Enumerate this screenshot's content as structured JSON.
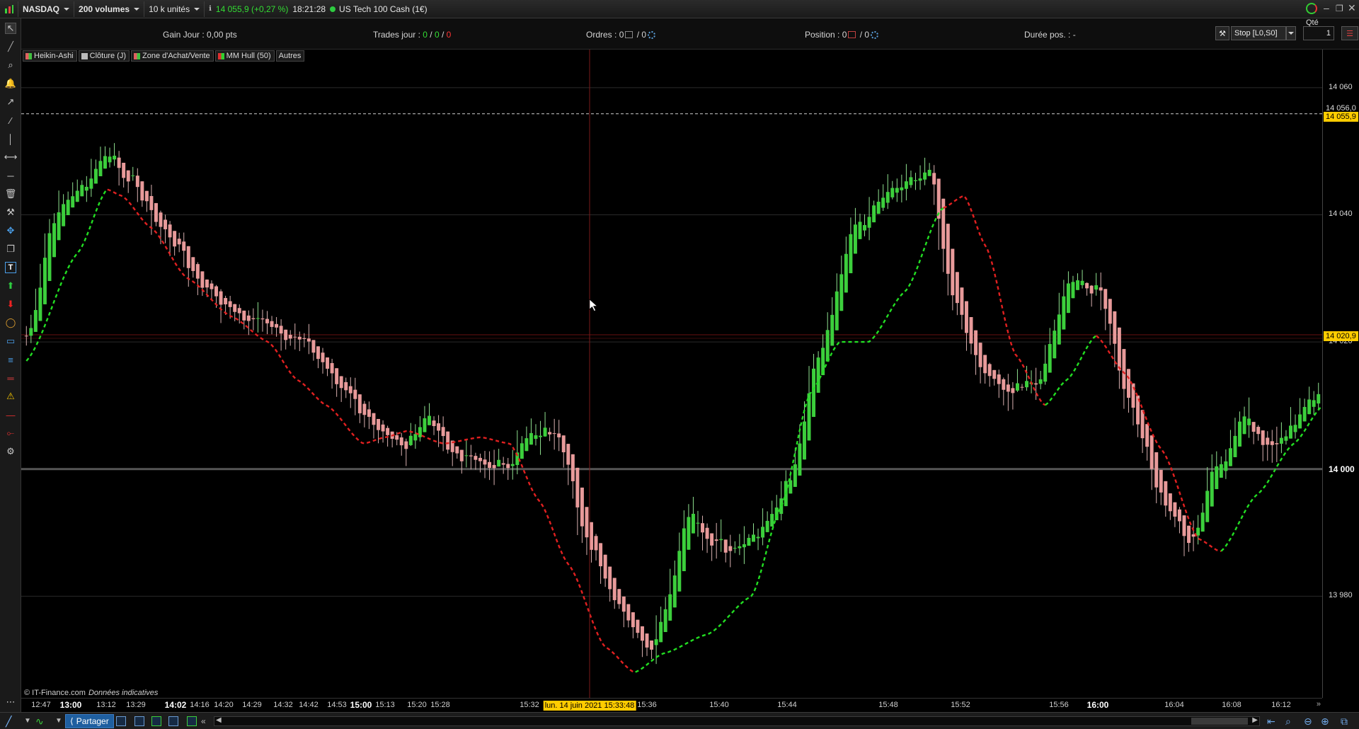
{
  "toolbar": {
    "market": "NASDAQ",
    "volume": "200 volumes",
    "units": "10 k unités",
    "price_change": "14 055,9 (+0,27 %)",
    "time": "18:21:28",
    "instrument": "US Tech 100 Cash (1€)",
    "qty_label": "Qté"
  },
  "infobar": {
    "gain_label": "Gain Jour :",
    "gain_value": "0,00 pts",
    "trades_label": "Trades jour :",
    "trades_a": "0",
    "trades_b": "0",
    "trades_c": "0",
    "orders_label": "Ordres :",
    "orders_a": "0",
    "orders_b": "0",
    "position_label": "Position :",
    "position_a": "0",
    "position_b": "0",
    "duration_label": "Durée pos. :",
    "duration_value": "-"
  },
  "order_entry": {
    "order_type": "Stop [L0,S0]",
    "quantity": "1"
  },
  "legend": [
    {
      "label": "Heikin-Ashi",
      "color": "#e06060",
      "color2": "#40c040"
    },
    {
      "label": "Clôture (J)",
      "color": "#bbbbbb"
    },
    {
      "label": "Zone d'Achat/Vente",
      "color": "#e06060",
      "color2": "#40c040"
    },
    {
      "label": "MM Hull (50)",
      "color": "#e03030",
      "color2": "#30d030"
    },
    {
      "label": "Autres",
      "color": ""
    }
  ],
  "chart_data": {
    "type": "candlestick",
    "instrument": "US Tech 100 Cash (1€)",
    "ylim": [
      13964,
      14066
    ],
    "yticks": [
      {
        "label": "14 060",
        "value": 14060,
        "bold": false
      },
      {
        "label": "14 040",
        "value": 14040,
        "bold": false
      },
      {
        "label": "14 020",
        "value": 14020,
        "bold": false
      },
      {
        "label": "14 000",
        "value": 14000,
        "bold": true
      },
      {
        "label": "13 980",
        "value": 13980,
        "bold": false
      }
    ],
    "price_badges": [
      {
        "label": "14 056,0",
        "value": 14056.0,
        "style": "plain"
      },
      {
        "label": "14 055,9",
        "value": 14055.9,
        "style": "yellow"
      },
      {
        "label": "14 020,9",
        "value": 14020.9,
        "style": "yellow"
      }
    ],
    "hlines": [
      {
        "value": 14055.9,
        "style": "dashed-white"
      },
      {
        "value": 14020.9,
        "style": "solid-darkred"
      },
      {
        "value": 14000,
        "style": "thick-grey"
      }
    ],
    "xticks": [
      {
        "label": "12:47",
        "bold": false
      },
      {
        "label": "13:00",
        "bold": true
      },
      {
        "label": "13:12",
        "bold": false
      },
      {
        "label": "13:29",
        "bold": false
      },
      {
        "label": "14:02",
        "bold": true
      },
      {
        "label": "14:16",
        "bold": false
      },
      {
        "label": "14:20",
        "bold": false
      },
      {
        "label": "14:29",
        "bold": false
      },
      {
        "label": "14:32",
        "bold": false
      },
      {
        "label": "14:42",
        "bold": false
      },
      {
        "label": "14:53",
        "bold": false
      },
      {
        "label": "15:00",
        "bold": true
      },
      {
        "label": "15:13",
        "bold": false
      },
      {
        "label": "15:20",
        "bold": false
      },
      {
        "label": "15:28",
        "bold": false
      },
      {
        "label": "15:32",
        "bold": false
      },
      {
        "label": "15:36",
        "bold": false
      },
      {
        "label": "15:40",
        "bold": false
      },
      {
        "label": "15:44",
        "bold": false
      },
      {
        "label": "15:48",
        "bold": false
      },
      {
        "label": "15:52",
        "bold": false
      },
      {
        "label": "15:56",
        "bold": false
      },
      {
        "label": "16:00",
        "bold": true
      },
      {
        "label": "16:04",
        "bold": false
      },
      {
        "label": "16:08",
        "bold": false
      },
      {
        "label": "16:12",
        "bold": false
      }
    ],
    "cursor_label": "lun. 14 juin 2021 15:33:48",
    "candle_count": 280,
    "close_path": [
      [
        0,
        14021
      ],
      [
        7,
        14040
      ],
      [
        14,
        14044
      ],
      [
        22,
        14050
      ],
      [
        28,
        14045
      ],
      [
        38,
        14037
      ],
      [
        48,
        14029
      ],
      [
        58,
        14024
      ],
      [
        66,
        14023
      ],
      [
        75,
        14020
      ],
      [
        86,
        14013
      ],
      [
        96,
        14005
      ],
      [
        102,
        14004
      ],
      [
        108,
        14008
      ],
      [
        118,
        14002
      ],
      [
        128,
        14000
      ],
      [
        138,
        14005
      ],
      [
        144,
        14007
      ],
      [
        152,
        13990
      ],
      [
        162,
        13978
      ],
      [
        170,
        13972
      ],
      [
        175,
        13980
      ],
      [
        180,
        13993
      ],
      [
        186,
        13989
      ],
      [
        192,
        13988
      ],
      [
        200,
        13990
      ],
      [
        208,
        13998
      ],
      [
        216,
        14018
      ],
      [
        226,
        14038
      ],
      [
        236,
        14044
      ],
      [
        246,
        14047
      ],
      [
        252,
        14028
      ],
      [
        260,
        14016
      ],
      [
        268,
        14012
      ],
      [
        276,
        14014
      ],
      [
        284,
        14030
      ],
      [
        292,
        14029
      ],
      [
        300,
        14012
      ],
      [
        310,
        13995
      ],
      [
        318,
        13988
      ],
      [
        324,
        14000
      ],
      [
        332,
        14008
      ],
      [
        340,
        14003
      ],
      [
        348,
        14009
      ],
      [
        354,
        14014
      ]
    ],
    "hull_path": [
      [
        0,
        14017
      ],
      [
        14,
        14034
      ],
      [
        22,
        14044
      ],
      [
        26,
        14043
      ],
      [
        34,
        14038
      ],
      [
        44,
        14030
      ],
      [
        56,
        14024
      ],
      [
        66,
        14020
      ],
      [
        74,
        14014
      ],
      [
        82,
        14010
      ],
      [
        92,
        14004
      ],
      [
        98,
        14005
      ],
      [
        104,
        14006
      ],
      [
        114,
        14004
      ],
      [
        124,
        14005
      ],
      [
        132,
        14004
      ],
      [
        140,
        13995
      ],
      [
        148,
        13985
      ],
      [
        158,
        13972
      ],
      [
        166,
        13968
      ],
      [
        174,
        13971
      ],
      [
        186,
        13974
      ],
      [
        198,
        13980
      ],
      [
        206,
        13994
      ],
      [
        214,
        14012
      ],
      [
        222,
        14020
      ],
      [
        230,
        14020
      ],
      [
        240,
        14028
      ],
      [
        250,
        14041
      ],
      [
        256,
        14043
      ],
      [
        262,
        14035
      ],
      [
        270,
        14018
      ],
      [
        278,
        14010
      ],
      [
        284,
        14014
      ],
      [
        292,
        14021
      ],
      [
        300,
        14015
      ],
      [
        310,
        14003
      ],
      [
        320,
        13989
      ],
      [
        326,
        13987
      ],
      [
        336,
        13996
      ],
      [
        346,
        14004
      ],
      [
        354,
        14010
      ]
    ],
    "hull_up_segments": [
      [
        0,
        22
      ],
      [
        166,
        250
      ],
      [
        278,
        292
      ],
      [
        326,
        354
      ]
    ]
  },
  "copyright": {
    "source": "© IT-Finance.com",
    "note": "Données indicatives"
  },
  "bottombar": {
    "share_label": "Partager"
  },
  "colors": {
    "up": "#3ccf3c",
    "down": "#e89a9a",
    "hull_up": "#22dd22",
    "hull_down": "#e02020",
    "badge": "#ffcc00"
  }
}
